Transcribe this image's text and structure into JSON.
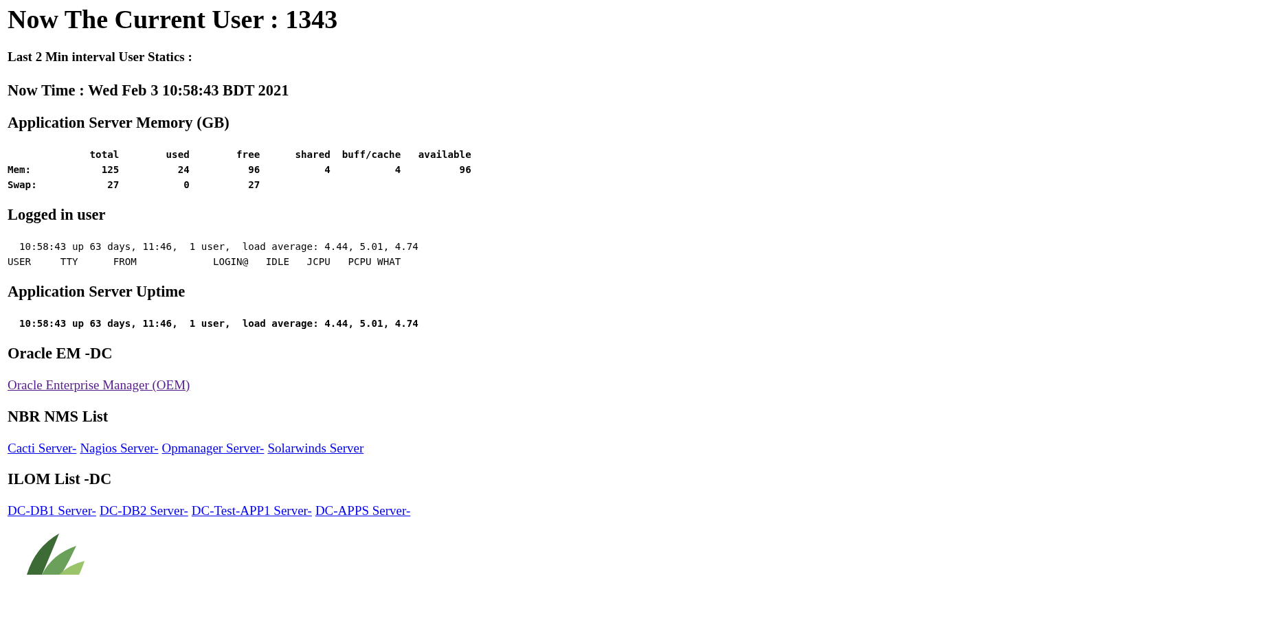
{
  "title": "Now The Current User : 1343",
  "subtitle": "Last 2 Min interval User Statics :",
  "now_time": "Now Time : Wed Feb 3 10:58:43 BDT 2021",
  "memory": {
    "heading": "Application Server Memory (GB)",
    "columns": [
      "total",
      "used",
      "free",
      "shared",
      "buff/cache",
      "available"
    ],
    "rows": [
      {
        "label": "Mem:",
        "cells": [
          "125",
          "24",
          "96",
          "4",
          "4",
          "96"
        ]
      },
      {
        "label": "Swap:",
        "cells": [
          "27",
          "0",
          "27"
        ]
      }
    ]
  },
  "logged_in": {
    "heading": "Logged in user",
    "lines": [
      "  10:58:43 up 63 days, 11:46,  1 user,  load average: 4.44, 5.01, 4.74",
      "USER     TTY      FROM             LOGIN@   IDLE   JCPU   PCPU WHAT"
    ]
  },
  "uptime": {
    "heading": "Application Server Uptime",
    "lines": [
      "  10:58:43 up 63 days, 11:46,  1 user,  load average: 4.44, 5.01, 4.74"
    ]
  },
  "sections": [
    {
      "heading": "Oracle EM -DC",
      "links": [
        {
          "label": "Oracle Enterprise Manager (OEM)",
          "visited": true
        }
      ]
    },
    {
      "heading": "NBR NMS List",
      "links": [
        {
          "label": "Cacti Server-",
          "visited": false
        },
        {
          "label": "Nagios Server-",
          "visited": false
        },
        {
          "label": "Opmanager Server-",
          "visited": false
        },
        {
          "label": "Solarwinds Server",
          "visited": false
        }
      ]
    },
    {
      "heading": "ILOM List -DC",
      "links": [
        {
          "label": "DC-DB1 Server-",
          "visited": false
        },
        {
          "label": "DC-DB2 Server-",
          "visited": false
        },
        {
          "label": "DC-Test-APP1 Server-",
          "visited": false
        },
        {
          "label": "DC-APPS Server-",
          "visited": false
        }
      ]
    }
  ]
}
